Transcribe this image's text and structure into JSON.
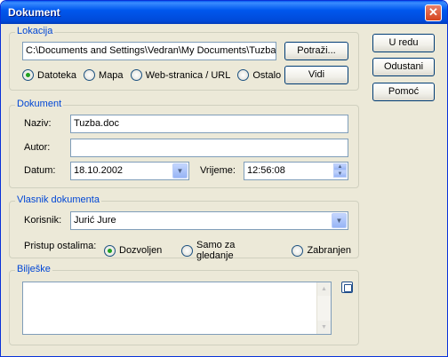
{
  "window": {
    "title": "Dokument",
    "close_glyph": "✕"
  },
  "buttons": {
    "ok": "U redu",
    "cancel": "Odustani",
    "help": "Pomoć"
  },
  "location": {
    "legend": "Lokacija",
    "path": "C:\\Documents and Settings\\Vedran\\My Documents\\Tuzba",
    "browse": "Potraži...",
    "view": "Vidi",
    "types": [
      "Datoteka",
      "Mapa",
      "Web-stranica / URL",
      "Ostalo"
    ],
    "selected_type": "Datoteka"
  },
  "document": {
    "legend": "Dokument",
    "name_label": "Naziv:",
    "name_value": "Tuzba.doc",
    "author_label": "Autor:",
    "author_value": "",
    "date_label": "Datum:",
    "date_value": "18.10.2002",
    "time_label": "Vrijeme:",
    "time_value": "12:56:08"
  },
  "owner": {
    "legend": "Vlasnik dokumenta",
    "user_label": "Korisnik:",
    "user_value": "Jurić Jure",
    "access_label": "Pristup ostalima:",
    "access_options": [
      "Dozvoljen",
      "Samo za gledanje",
      "Zabranjen"
    ],
    "selected_access": "Dozvoljen"
  },
  "notes": {
    "legend": "Bilješke",
    "value": ""
  }
}
